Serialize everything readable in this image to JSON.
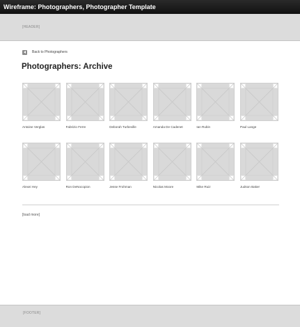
{
  "window": {
    "title": "Wireframe: Photographers, Photographer Template"
  },
  "header": {
    "label": "[HEADER]"
  },
  "nav": {
    "back_label": "Back to Photographers",
    "back_icon": "arrow-left-icon"
  },
  "page": {
    "title": "Photographers: Archive"
  },
  "photographers": [
    {
      "name": "Antoine Verglas"
    },
    {
      "name": "Fabrizio Ferre"
    },
    {
      "name": "Deborah Turbeville"
    },
    {
      "name": "Amanda De Cadenet"
    },
    {
      "name": "Ian Rubin"
    },
    {
      "name": "Paul Lange"
    },
    {
      "name": "Alexei Hey"
    },
    {
      "name": "Ron DeNocopion"
    },
    {
      "name": "Jesse Frohman"
    },
    {
      "name": "Nicolas Moore"
    },
    {
      "name": "Mike Ruiz"
    },
    {
      "name": "Judson Baker"
    }
  ],
  "read_more": {
    "label": "[load more]"
  },
  "footer": {
    "label": "[FOOTER]"
  },
  "colors": {
    "titlebar": "#1a1a1a",
    "band": "#dcdcdc",
    "placeholder": "#d9d9d9"
  }
}
